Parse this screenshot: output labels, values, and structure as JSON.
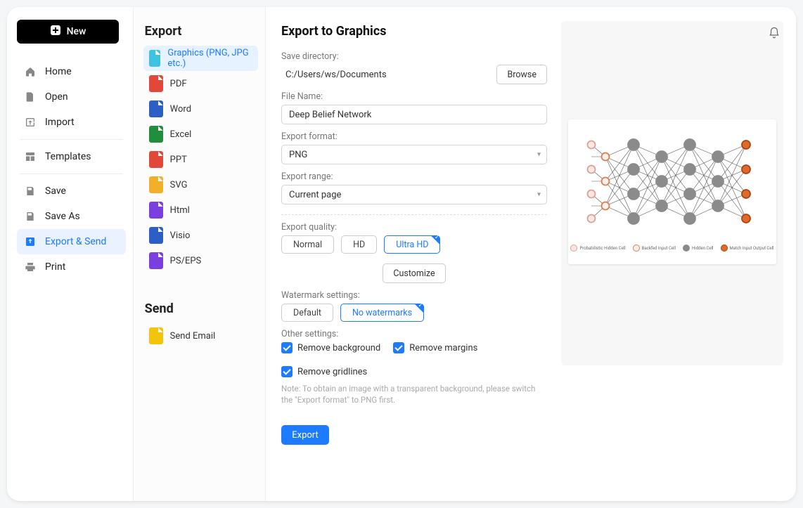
{
  "header": {
    "new_label": "New"
  },
  "sidebar": {
    "items": [
      {
        "label": "Home"
      },
      {
        "label": "Open"
      },
      {
        "label": "Import"
      },
      {
        "label": "Templates"
      },
      {
        "label": "Save"
      },
      {
        "label": "Save As"
      },
      {
        "label": "Export & Send"
      },
      {
        "label": "Print"
      }
    ]
  },
  "export_panel": {
    "export_title": "Export",
    "send_title": "Send",
    "formats": [
      {
        "label": "Graphics (PNG, JPG etc.)",
        "color": "#3fc3e0"
      },
      {
        "label": "PDF",
        "color": "#e2483a"
      },
      {
        "label": "Word",
        "color": "#2b5fc5"
      },
      {
        "label": "Excel",
        "color": "#1f8f3c"
      },
      {
        "label": "PPT",
        "color": "#e2483a"
      },
      {
        "label": "SVG",
        "color": "#f2b02a"
      },
      {
        "label": "Html",
        "color": "#7b3fe0"
      },
      {
        "label": "Visio",
        "color": "#2b5fc5"
      },
      {
        "label": "PS/EPS",
        "color": "#7b3fe0"
      }
    ],
    "send_items": [
      {
        "label": "Send Email",
        "color": "#f2c50a"
      }
    ]
  },
  "form": {
    "page_title": "Export to Graphics",
    "save_dir_label": "Save directory:",
    "save_dir_value": "C:/Users/ws/Documents",
    "browse_label": "Browse",
    "file_name_label": "File Name:",
    "file_name_value": "Deep Belief Network",
    "format_label": "Export format:",
    "format_value": "PNG",
    "range_label": "Export range:",
    "range_value": "Current page",
    "quality_label": "Export quality:",
    "quality_options": {
      "normal": "Normal",
      "hd": "HD",
      "ultra": "Ultra HD"
    },
    "customize_label": "Customize",
    "watermark_label": "Watermark settings:",
    "watermark_options": {
      "default": "Default",
      "none": "No watermarks"
    },
    "other_label": "Other settings:",
    "checks": {
      "bg": "Remove background",
      "margins": "Remove margins",
      "grid": "Remove gridlines"
    },
    "note": "Note: To obtain an image with a transparent background, please switch the \"Export format\" to PNG first.",
    "export_btn": "Export"
  },
  "preview": {
    "legend": {
      "prob": "Probabilistic Hidden Cell",
      "backfed": "Backfed Input Cell",
      "hidden": "Hidden Cell",
      "match": "Match Input Output Cell"
    },
    "colors": {
      "prob": {
        "fill": "#fbe8e3",
        "stroke": "#d8a295"
      },
      "backfed": {
        "fill": "#fef0eb",
        "stroke": "#e07a4d"
      },
      "hidden": {
        "fill": "#8b8b8b",
        "stroke": "#8b8b8b"
      },
      "match": {
        "fill": "#e06a2c",
        "stroke": "#a64613"
      }
    }
  }
}
